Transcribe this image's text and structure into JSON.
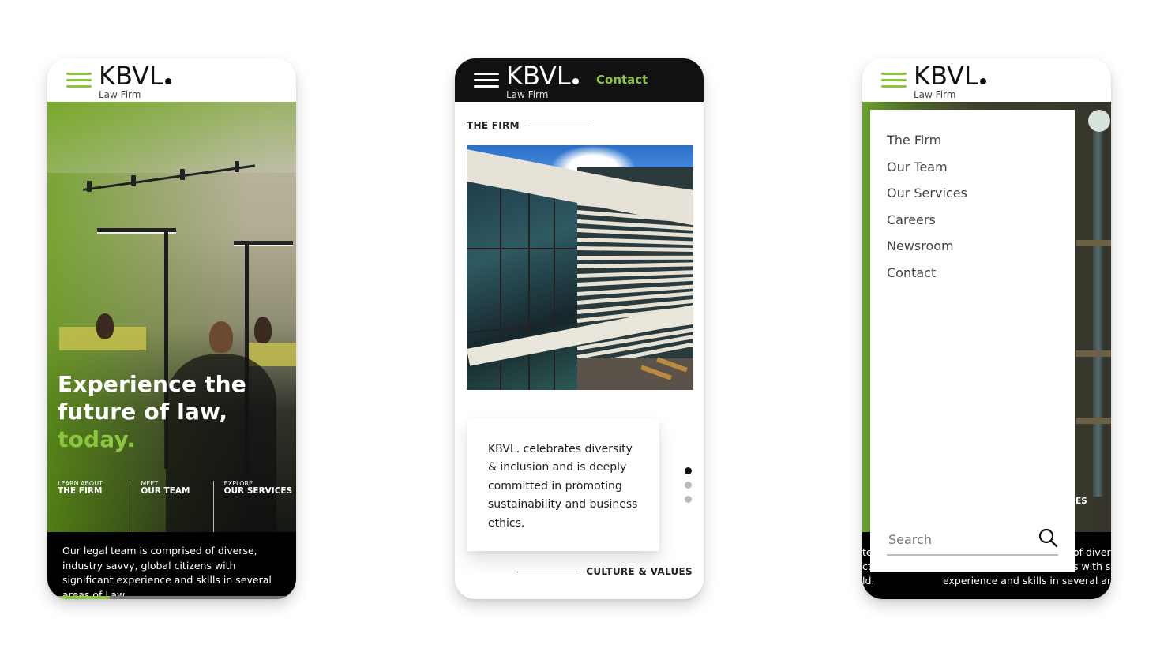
{
  "brand": {
    "name": "KBVL",
    "tagline": "Law Firm",
    "accent_color": "#8cc63f"
  },
  "phone_home": {
    "headline_line1": "Experience the",
    "headline_line2": "future of law,",
    "headline_accent": "today.",
    "quick_links": [
      {
        "small": "Learn About",
        "big": "The Firm"
      },
      {
        "small": "Meet",
        "big": "Our Team"
      },
      {
        "small": "Explore",
        "big": "Our Services"
      }
    ],
    "intro_text": "Our legal team is comprised of diverse, industry savvy, global citizens with significant experience and skills in several areas of Law.",
    "slide_progress": 0.25
  },
  "phone_firm": {
    "header_link": "Contact",
    "section_label": "THE FIRM",
    "quote": "KBVL. celebrates diversity & inclusion and is deeply committed in promoting sustainability and business ethics.",
    "carousel": {
      "total": 3,
      "active": 1
    },
    "next_section_label": "CULTURE & VALUES"
  },
  "phone_menu": {
    "menu_items": [
      "The Firm",
      "Our Team",
      "Our Services",
      "Careers",
      "Newsroom",
      "Contact"
    ],
    "search_placeholder": "Search",
    "bg_partial_label": "ES",
    "bg_text_left": [
      "te",
      "ct",
      "ld."
    ],
    "bg_text_right": [
      "of divers",
      "s with sig",
      "experience and skills in several areas"
    ]
  }
}
